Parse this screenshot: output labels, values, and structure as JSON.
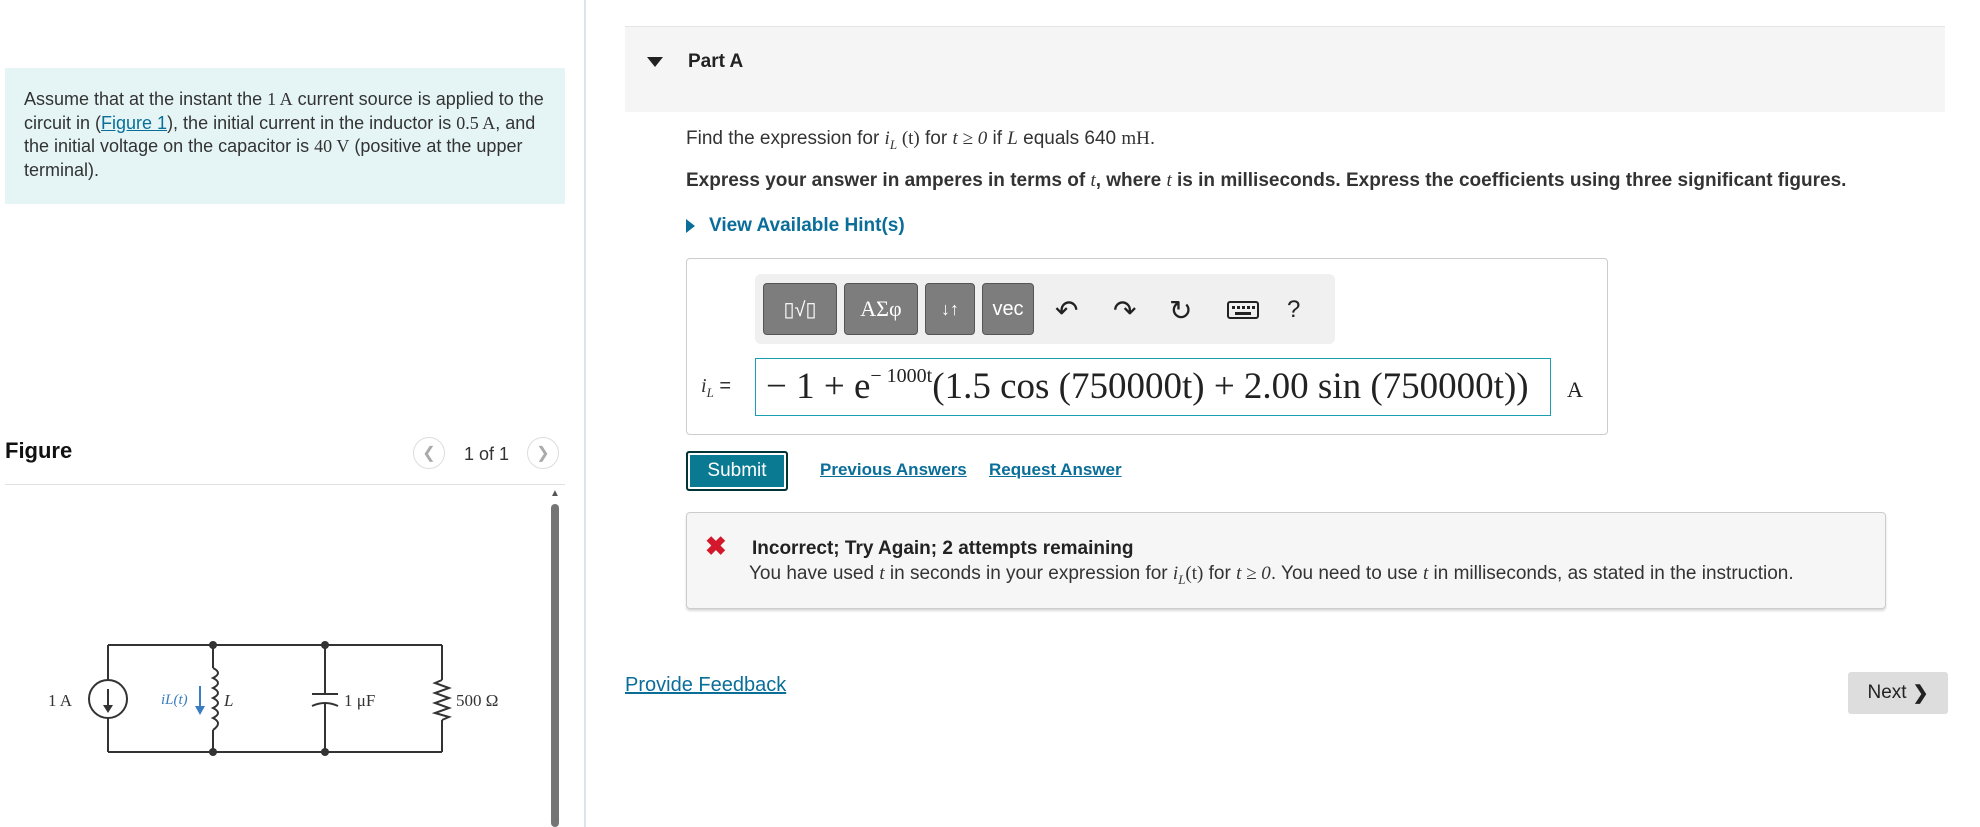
{
  "problem": {
    "t1": "Assume that at the instant the ",
    "m1": "1 A",
    "t2": " current source is applied to the circuit in (",
    "link": "Figure 1",
    "t3": "), the initial current in the inductor is ",
    "m2": "0.5 A",
    "t4": ", and the initial voltage on the capacitor is ",
    "m3": "40 V",
    "t5": " (positive at the upper terminal)."
  },
  "figure": {
    "title": "Figure",
    "pager": "1 of 1",
    "prev_icon": "chevron-left-icon",
    "next_icon": "chevron-right-icon",
    "labels": {
      "source": "1 A",
      "current": "iL(t)",
      "inductor": "L",
      "capacitor": "1 μF",
      "resistor": "500 Ω"
    }
  },
  "part": {
    "title": "Part A",
    "caret_icon": "caret-down-icon"
  },
  "question": {
    "a": "Find the expression for ",
    "b": "i",
    "c": "L",
    "d": " (t)",
    "e": " for ",
    "f": "t ≥ 0",
    "g": " if ",
    "h": "L",
    "i": " equals 640 ",
    "j": "mH",
    "k": "."
  },
  "instruction": {
    "a": "Express your answer in amperes in terms of ",
    "b": "t",
    "c": ", where ",
    "d": "t",
    "e": " is in milliseconds. Express the coefficients using three significant figures."
  },
  "hint": {
    "label": "View Available Hint(s)"
  },
  "toolbar": {
    "templates": "▯√▯",
    "greek": "ΑΣφ",
    "arrows": "↓↑",
    "vec": "vec",
    "undo_icon": "undo-icon",
    "redo_icon": "redo-icon",
    "reset_icon": "reset-icon",
    "keyboard_icon": "keyboard-icon",
    "help": "?"
  },
  "answer": {
    "label_i": "i",
    "label_sub": "L",
    "label_eq": " =",
    "p1": "− 1 + e",
    "exp": "− 1000t",
    "p2": "(1.5 cos (750000t) + 2.00 sin (750000t))",
    "unit": "A"
  },
  "actions": {
    "submit": "Submit",
    "previous_answers": "Previous Answers",
    "request_answer": "Request Answer"
  },
  "feedback": {
    "icon": "x-icon",
    "title": "Incorrect; Try Again; 2 attempts remaining",
    "m1": "You have used ",
    "m2": "t",
    "m3": " in seconds in your expression for ",
    "m4": "i",
    "m5": "L",
    "m6": "(t)",
    "m7": " for ",
    "m8": "t ≥ 0",
    "m9": ". You need to use ",
    "m10": "t",
    "m11": " in milliseconds, as stated in the instruction."
  },
  "footer": {
    "provide_feedback": "Provide Feedback",
    "next": "Next"
  },
  "colors": {
    "accent": "#0a6e99",
    "submit": "#0a7a93",
    "problem_bg": "#e5f5f5",
    "error": "#d3182b"
  }
}
